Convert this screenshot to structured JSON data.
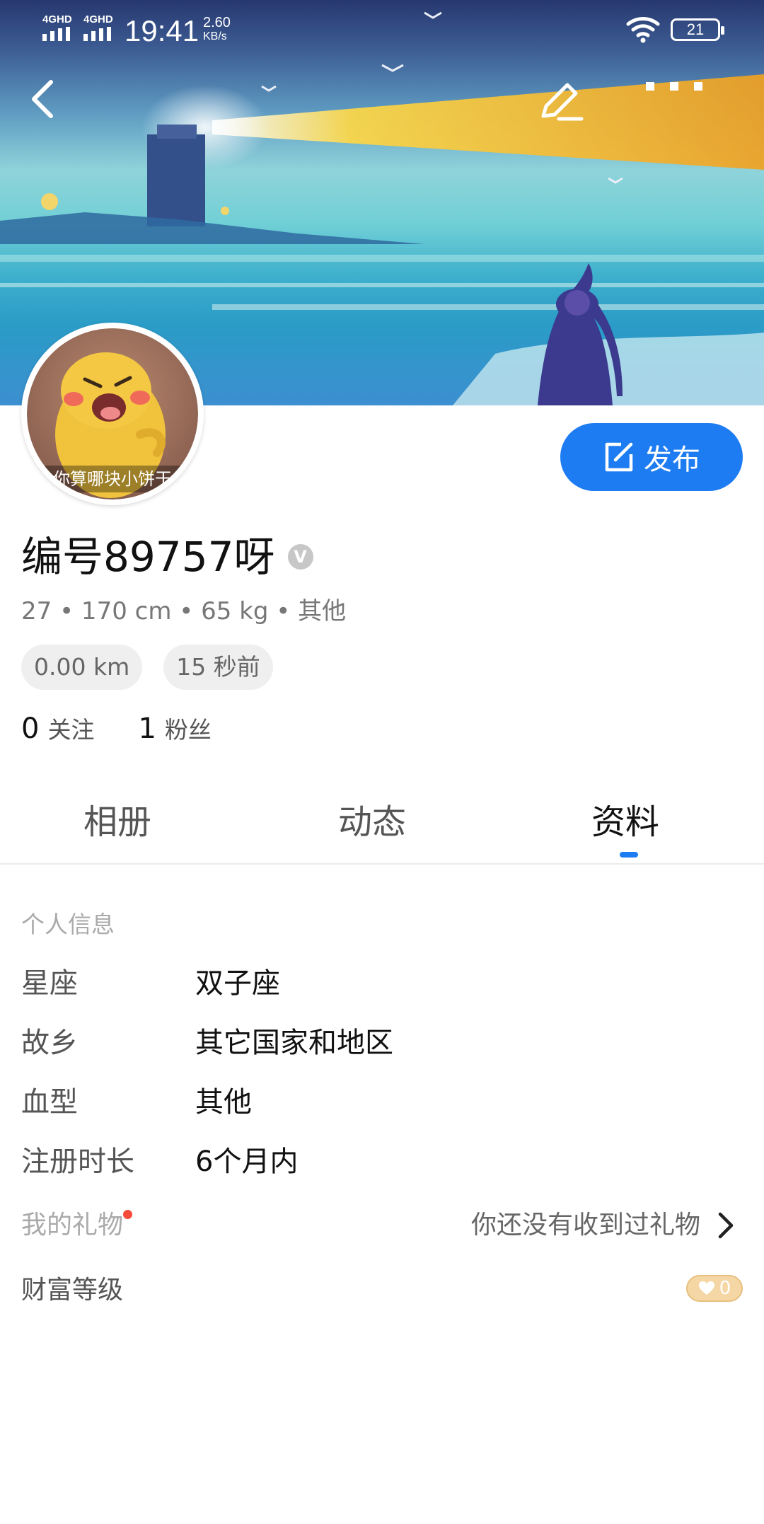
{
  "status_bar": {
    "signal_1": "4GHD",
    "signal_2": "4GHD",
    "time": "19:41",
    "net_speed": "2.60",
    "net_unit": "KB/s",
    "battery": "21"
  },
  "profile": {
    "avatar_caption": "你算哪块小饼干",
    "nickname": "编号89757呀",
    "verify_badge": "V",
    "attributes": "27 • 170 cm • 65 kg • 其他",
    "distance": "0.00 km",
    "last_active": "15 秒前",
    "following_count": "0",
    "following_label": "关注",
    "followers_count": "1",
    "followers_label": "粉丝"
  },
  "actions": {
    "publish_label": "发布"
  },
  "tabs": [
    {
      "label": "相册",
      "active": false
    },
    {
      "label": "动态",
      "active": false
    },
    {
      "label": "资料",
      "active": true
    }
  ],
  "details": {
    "section_title": "个人信息",
    "rows": [
      {
        "label": "星座",
        "value": "双子座"
      },
      {
        "label": "故乡",
        "value": "其它国家和地区"
      },
      {
        "label": "血型",
        "value": "其他"
      },
      {
        "label": "注册时长",
        "value": "6个月内"
      }
    ],
    "gift_label": "我的礼物",
    "gift_value": "你还没有收到过礼物",
    "wealth_label": "财富等级",
    "wealth_level": "0"
  },
  "colors": {
    "accent": "#1e7cf2",
    "notification_dot": "#f44b3b",
    "wealth_badge": "#f5d7a5"
  }
}
